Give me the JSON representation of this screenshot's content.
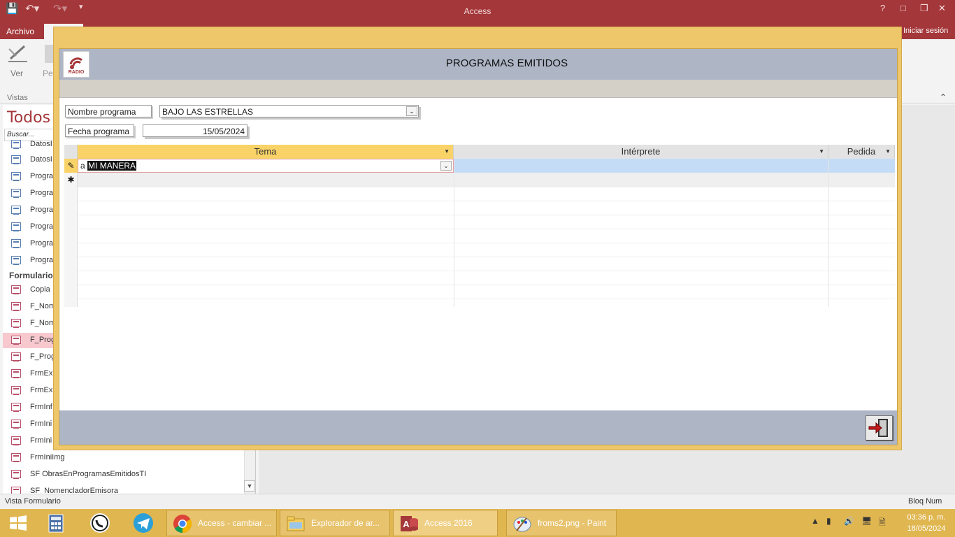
{
  "app": {
    "title": "Access",
    "sign_in": "Iniciar sesión"
  },
  "ribbon": {
    "file_tab": "Archivo",
    "view_label": "Ver",
    "paste_label": "Peg",
    "group_vistas": "Vistas"
  },
  "navpane": {
    "title": "Todos l",
    "search_placeholder": "Buscar...",
    "query_items": [
      "DatosI",
      "DatosI",
      "Progra",
      "Progra",
      "Progra",
      "Progra",
      "Progra",
      "Progra"
    ],
    "forms_group": "Formularios",
    "form_items": [
      "Copia",
      "F_Nom",
      "F_Nom",
      "F_Prog",
      "F_Prog",
      "FrmExp",
      "FrmExp",
      "FrmInf",
      "FrmIni",
      "FrmIni",
      "FrmIniImg",
      "SF ObrasEnProgramasEmitidosTI",
      "SF_NomencladorEmisora"
    ],
    "selected_form_index": 3
  },
  "form": {
    "title": "PROGRAMAS EMITIDOS",
    "logo_text": "RADIO",
    "program_name_label": "Nombre programa",
    "program_name_value": "BAJO LAS ESTRELLAS",
    "program_date_label": "Fecha programa",
    "program_date_value": "15/05/2024",
    "columns": [
      "Tema",
      "Intérprete",
      "Pedida"
    ],
    "current_row": {
      "typed": "a",
      "selected_text": "MI MANERA",
      "interprete": "",
      "pedida": ""
    }
  },
  "status": {
    "left": "Vista Formulario",
    "right": "Bloq Num"
  },
  "taskbar": {
    "items": [
      {
        "label": "Access - cambiar ...",
        "icon": "chrome-icon"
      },
      {
        "label": "Explorador de ar...",
        "icon": "folder-icon"
      },
      {
        "label": "Access 2016",
        "icon": "access-icon"
      },
      {
        "label": "froms2.png - Paint",
        "icon": "paint-icon"
      }
    ],
    "time": "03:36 p. m.",
    "date": "18/05/2024"
  },
  "colors": {
    "access_red": "#a4373a",
    "form_border": "#eec76a",
    "form_header": "#aeb6c6",
    "taskbar": "#e0b650"
  }
}
